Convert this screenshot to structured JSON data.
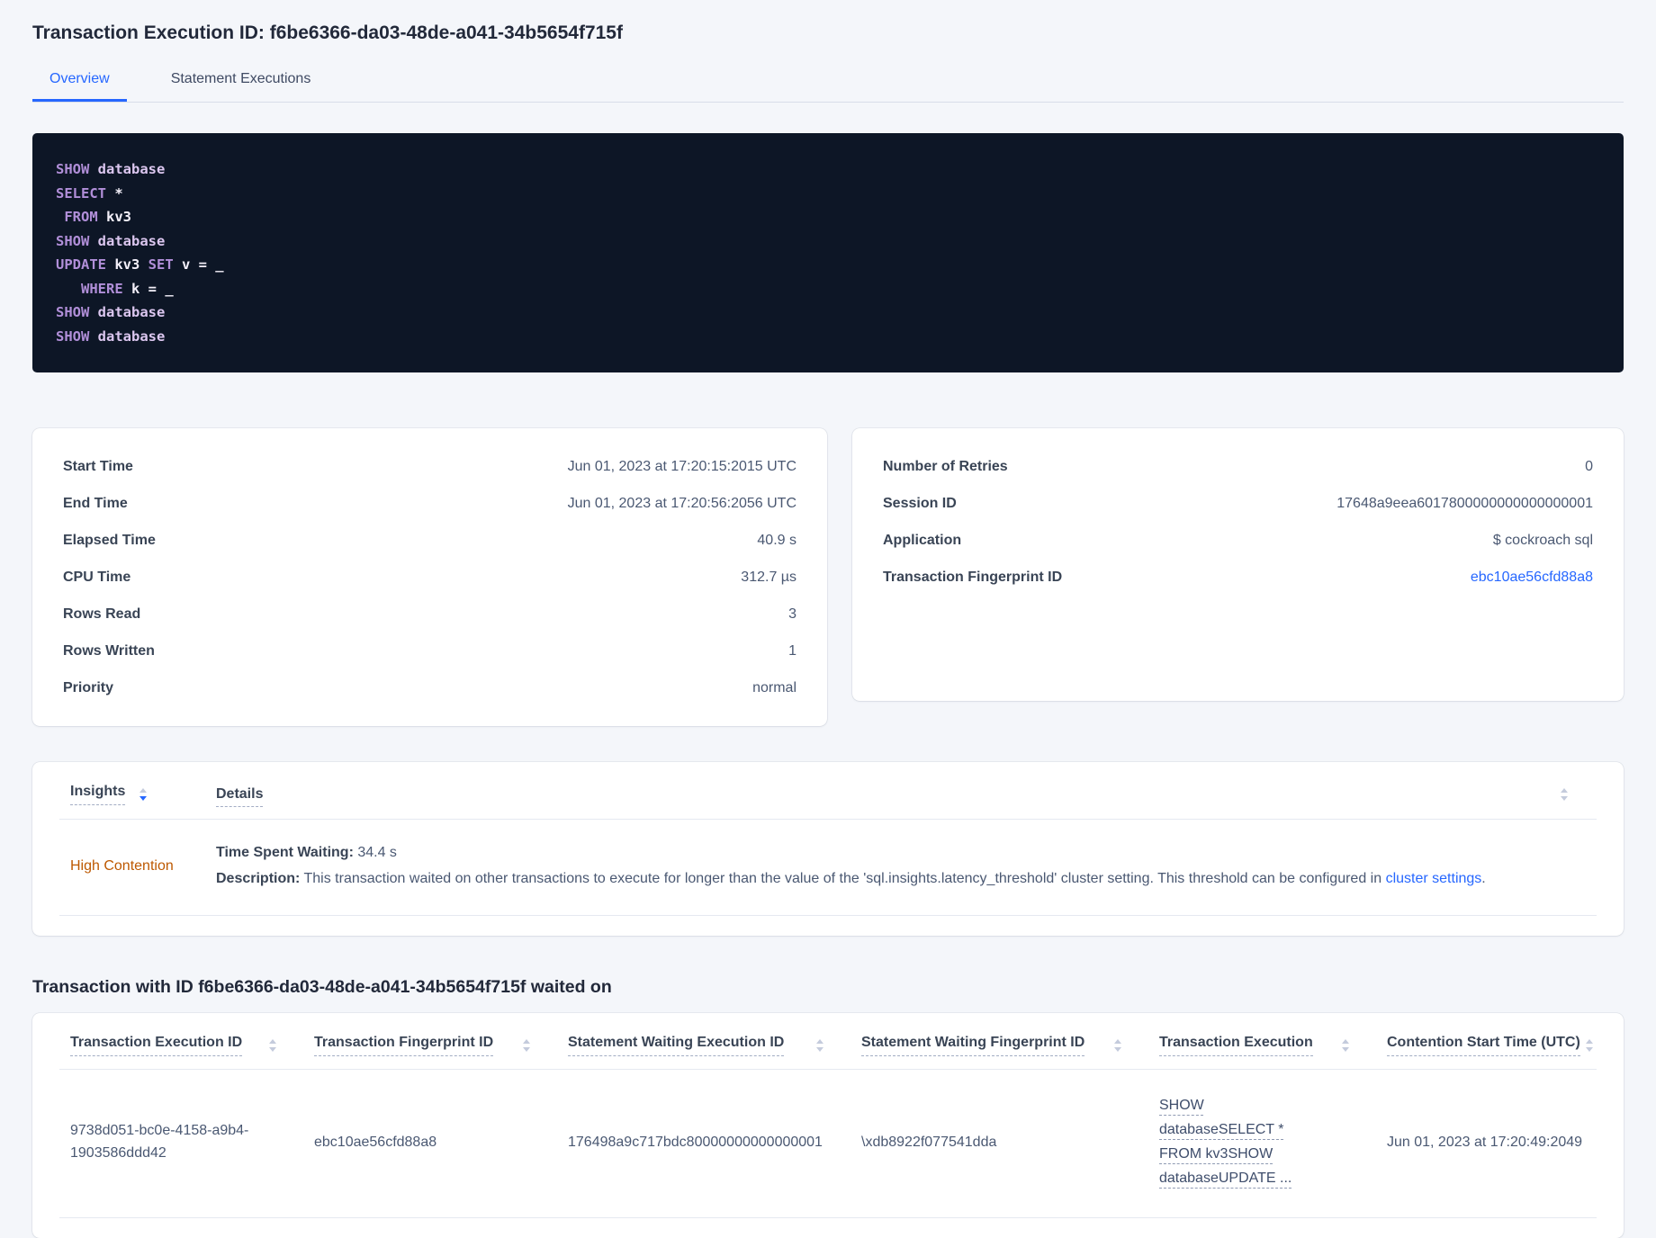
{
  "colors": {
    "accent": "#2667ff",
    "insight_warning": "#bd5800",
    "code_bg": "#0d1626",
    "code_keyword": "#b18fd9",
    "code_keyword_secondary": "#dcc7f0",
    "code_plain": "#f4f0fa"
  },
  "header": {
    "title": "Transaction Execution ID: f6be6366-da03-48de-a041-34b5654f715f",
    "tabs": [
      {
        "label": "Overview"
      },
      {
        "label": "Statement Executions"
      }
    ]
  },
  "sql": {
    "lines": [
      {
        "tokens": [
          {
            "t": "SHOW "
          },
          {
            "t": "database"
          }
        ]
      },
      {
        "tokens": [
          {
            "t": "SELECT "
          },
          {
            "t": "*"
          }
        ]
      },
      {
        "tokens": [
          {
            "t": " "
          },
          {
            "t": "FROM "
          },
          {
            "t": "kv3"
          }
        ]
      },
      {
        "tokens": [
          {
            "t": "SHOW "
          },
          {
            "t": "database"
          }
        ]
      },
      {
        "tokens": [
          {
            "t": "UPDATE "
          },
          {
            "t": "kv3 "
          },
          {
            "t": "SET "
          },
          {
            "t": "v = _"
          }
        ]
      },
      {
        "tokens": [
          {
            "t": "   "
          },
          {
            "t": "WHERE "
          },
          {
            "t": "k = _"
          }
        ]
      },
      {
        "tokens": [
          {
            "t": "SHOW "
          },
          {
            "t": "database"
          }
        ]
      },
      {
        "tokens": [
          {
            "t": "SHOW "
          },
          {
            "t": "database"
          }
        ]
      }
    ]
  },
  "summary_left": {
    "rows": [
      {
        "label": "Start Time",
        "value": "Jun 01, 2023 at 17:20:15:2015 UTC"
      },
      {
        "label": "End Time",
        "value": "Jun 01, 2023 at 17:20:56:2056 UTC"
      },
      {
        "label": "Elapsed Time",
        "value": "40.9 s"
      },
      {
        "label": "CPU Time",
        "value": "312.7 µs"
      },
      {
        "label": "Rows Read",
        "value": "3"
      },
      {
        "label": "Rows Written",
        "value": "1"
      },
      {
        "label": "Priority",
        "value": "normal"
      }
    ]
  },
  "summary_right": {
    "rows": [
      {
        "label": "Number of Retries",
        "value": "0"
      },
      {
        "label": "Session ID",
        "value": "17648a9eea6017800000000000000001"
      },
      {
        "label": "Application",
        "value": "$ cockroach sql"
      },
      {
        "label": "Transaction Fingerprint ID",
        "value": "ebc10ae56cfd88a8"
      }
    ]
  },
  "insights": {
    "col_insights": "Insights",
    "col_details": "Details",
    "row": {
      "insight": "High Contention",
      "waiting_label": "Time Spent Waiting:",
      "waiting_value": "34.4 s",
      "description_label": "Description:",
      "description_text": "This transaction waited on other transactions to execute for longer than the value of the 'sql.insights.latency_threshold' cluster setting. This threshold can be configured in",
      "description_link": "cluster settings",
      "description_suffix": "."
    }
  },
  "waited_on": {
    "heading": "Transaction with ID f6be6366-da03-48de-a041-34b5654f715f waited on",
    "columns": [
      {
        "label": "Transaction Execution ID"
      },
      {
        "label": "Transaction Fingerprint ID"
      },
      {
        "label": "Statement Waiting Execution ID"
      },
      {
        "label": "Statement Waiting Fingerprint ID"
      },
      {
        "label": "Transaction Execution"
      },
      {
        "label": "Contention Start Time (UTC)"
      }
    ],
    "rows": [
      {
        "transaction_execution_id": "9738d051-bc0e-4158-a9b4-1903586ddd42",
        "transaction_fingerprint_id": "ebc10ae56cfd88a8",
        "statement_waiting_execution_id": "176498a9c717bdc80000000000000001",
        "statement_waiting_fingerprint_id": "\\xdb8922f077541dda",
        "transaction_execution": "SHOW databaseSELECT * FROM kv3SHOW databaseUPDATE ...",
        "contention_start_time": "Jun 01, 2023 at 17:20:49:2049"
      }
    ]
  }
}
